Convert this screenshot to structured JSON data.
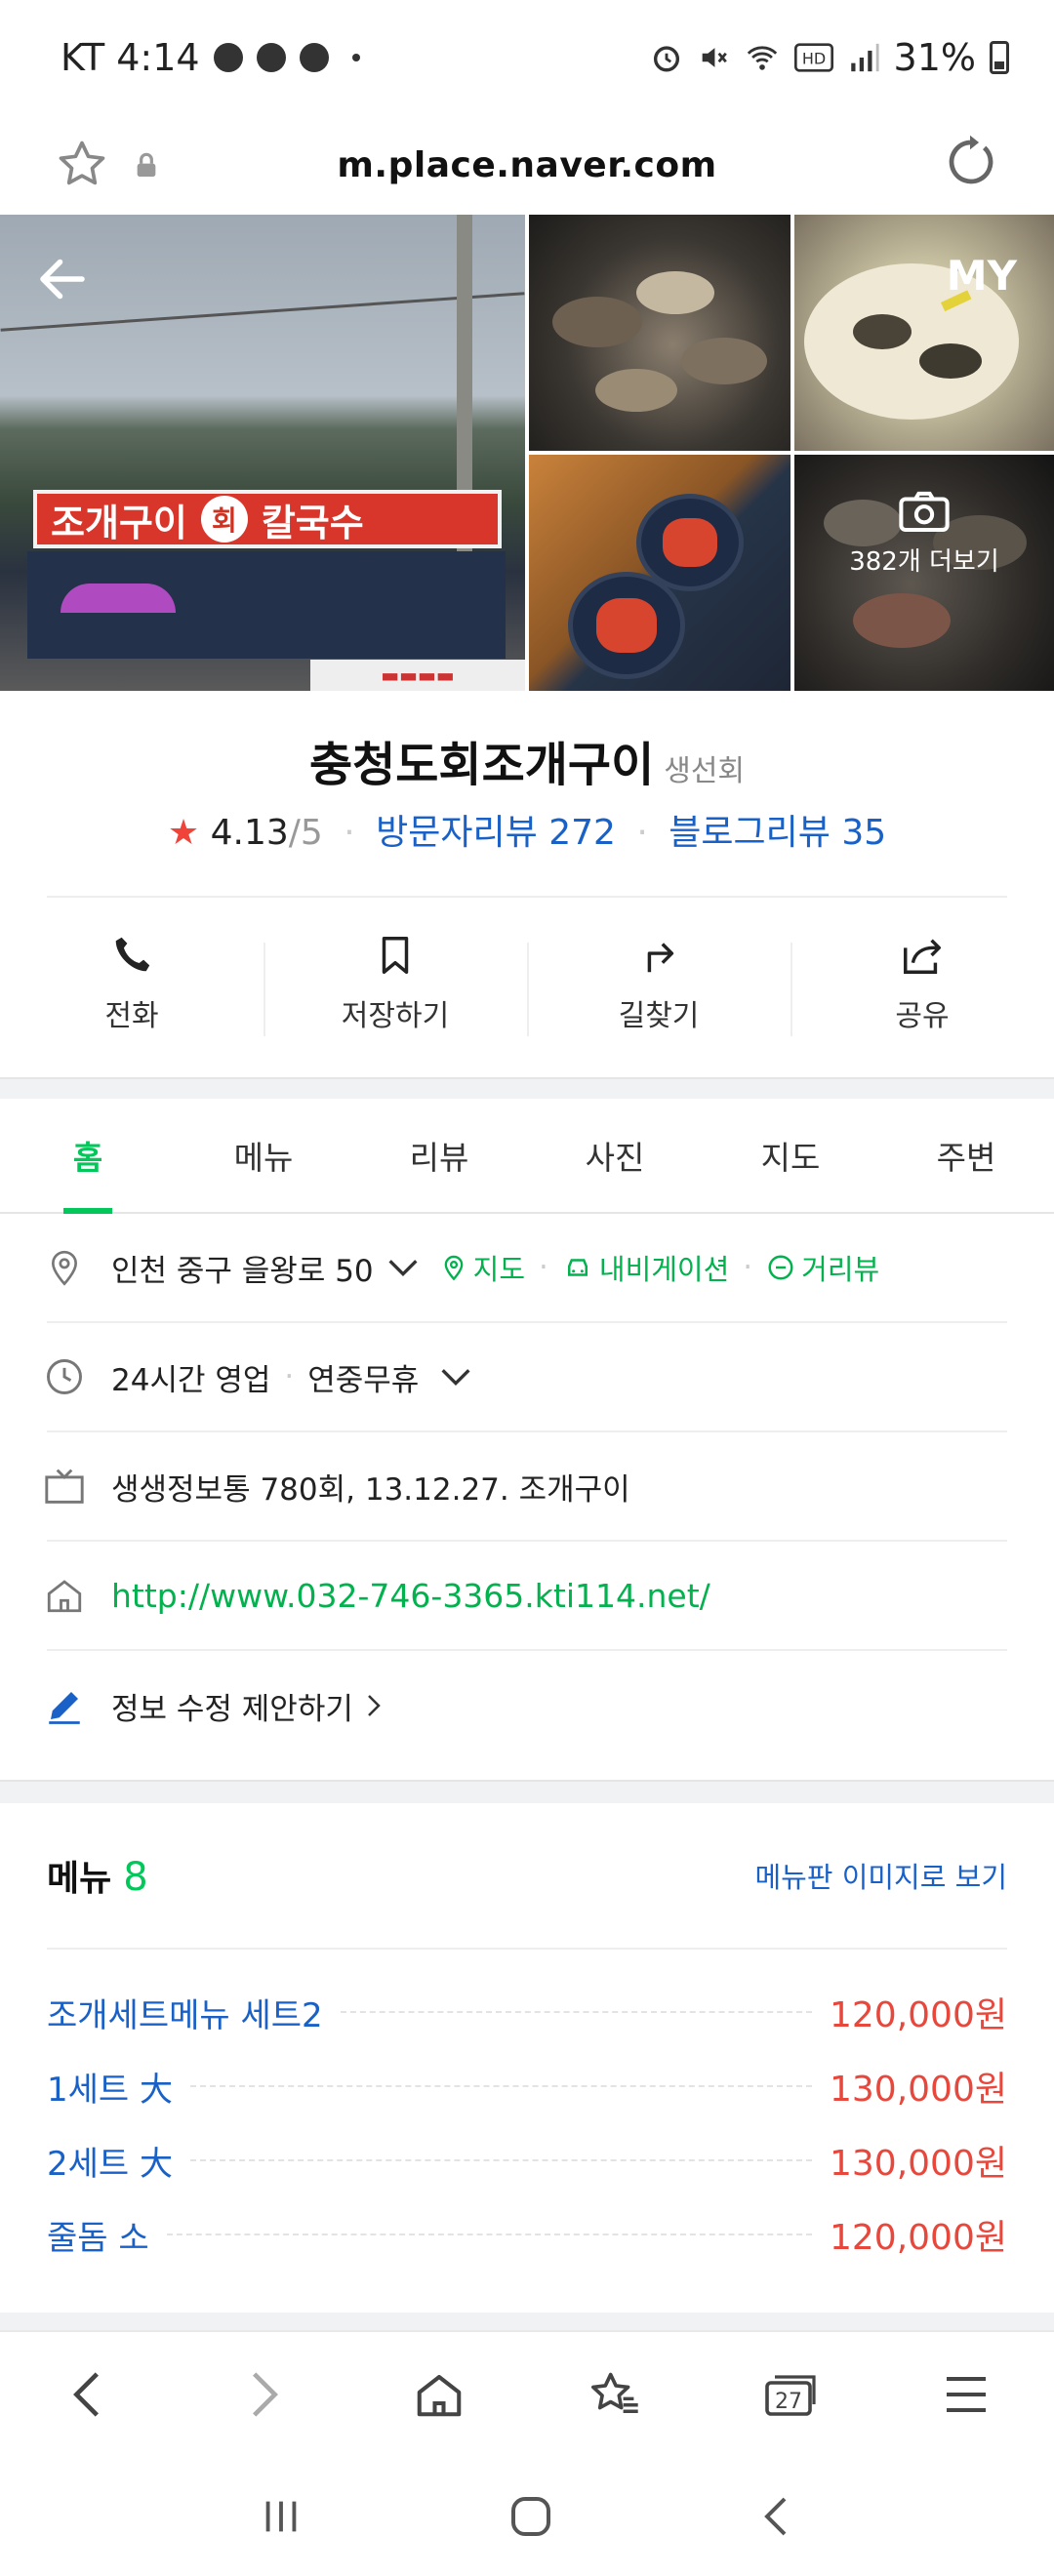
{
  "status_bar": {
    "carrier_time": "KT 4:14",
    "battery": "31%"
  },
  "browser": {
    "url": "m.place.naver.com"
  },
  "photos": {
    "sign_text_1": "조개구이",
    "sign_text_circle": "회",
    "sign_text_2": "칼국수",
    "my_label": "MY",
    "more_photos": "382개 더보기"
  },
  "place": {
    "name": "충청도회조개구이",
    "category": "생선회",
    "rating": "4.13",
    "rating_max": "/5",
    "visitor_reviews": "방문자리뷰 272",
    "blog_reviews": "블로그리뷰 35"
  },
  "actions": [
    {
      "label": "전화",
      "icon": "phone-icon"
    },
    {
      "label": "저장하기",
      "icon": "bookmark-icon"
    },
    {
      "label": "길찾기",
      "icon": "directions-icon"
    },
    {
      "label": "공유",
      "icon": "share-icon"
    }
  ],
  "tabs": [
    "홈",
    "메뉴",
    "리뷰",
    "사진",
    "지도",
    "주변"
  ],
  "info": {
    "address": "인천 중구 을왕로 50",
    "map_link": "지도",
    "navi_link": "내비게이션",
    "street_view_link": "거리뷰",
    "hours": "24시간 영업",
    "holiday": "연중무휴",
    "tv": "생생정보통 780회, 13.12.27. 조개구이",
    "website": "http://www.032-746-3365.kti114.net/",
    "edit_suggest": "정보 수정 제안하기"
  },
  "menu": {
    "title": "메뉴",
    "count": "8",
    "board_link": "메뉴판 이미지로 보기",
    "items": [
      {
        "name": "조개세트메뉴 세트2",
        "price": "120,000원"
      },
      {
        "name": "1세트 大",
        "price": "130,000원"
      },
      {
        "name": "2세트 大",
        "price": "130,000원"
      },
      {
        "name": "줄돔 소",
        "price": "120,000원"
      }
    ]
  },
  "bottom_bar": {
    "tabs_count": "27"
  },
  "colors": {
    "naver_green": "#03c75a",
    "link_blue": "#1961c7",
    "price_red": "#e8473c",
    "star_red": "#f0443a"
  }
}
